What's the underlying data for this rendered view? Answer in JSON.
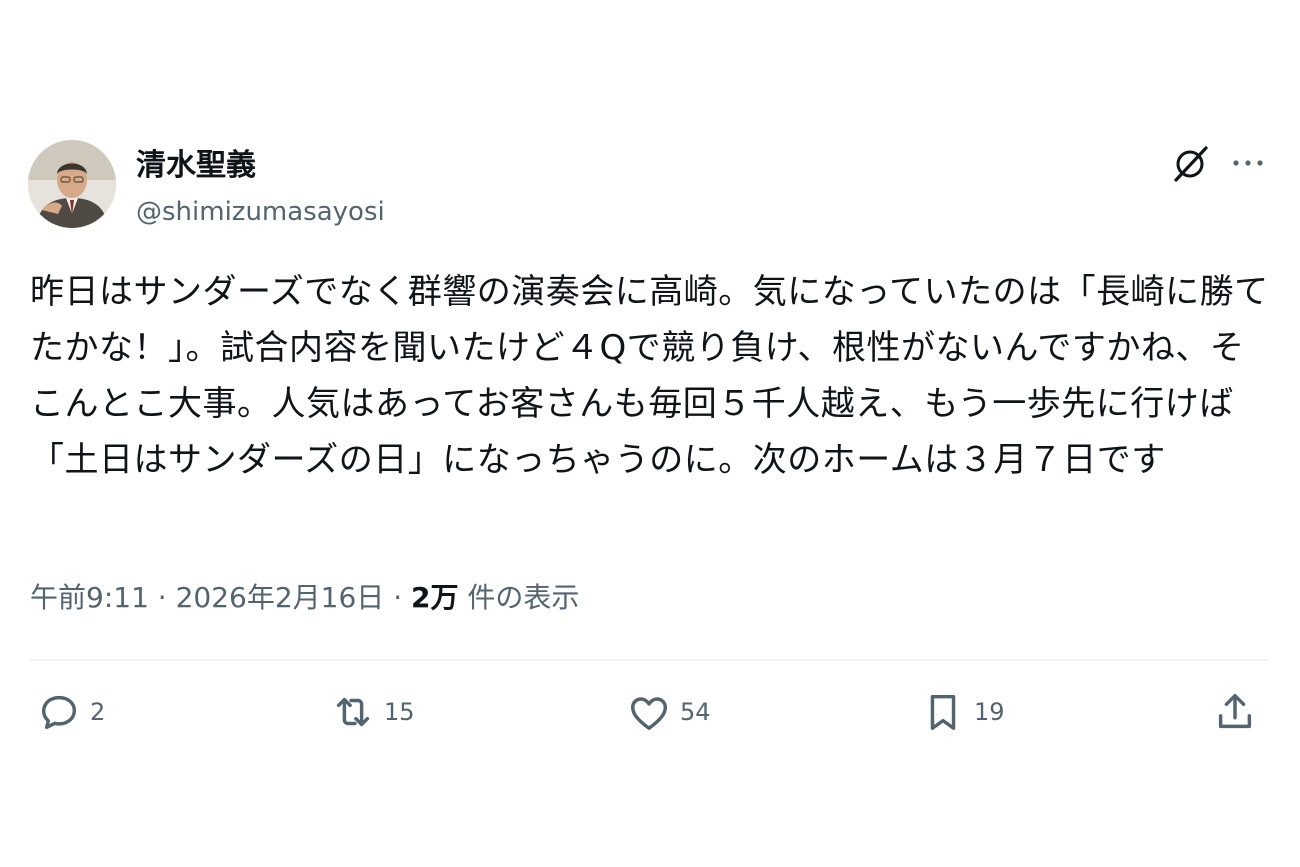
{
  "user": {
    "display_name": "清水聖義",
    "handle": "@shimizumasayosi"
  },
  "tweet": {
    "text": "昨日はサンダーズでなく群響の演奏会に高崎。気になっていたのは「長崎に勝てたかな！」。試合内容を聞いたけど４Qで競り負け、根性がないんですかね、そこんとこ大事。人気はあってお客さんも毎回５千人越え、もう一歩先に行けば「土日はサンダーズの日」になっちゃうのに。次のホームは３月７日です",
    "time": "午前9:11",
    "separator": "·",
    "date": "2026年2月16日",
    "views_count": "2万",
    "views_label": "件の表示"
  },
  "actions": {
    "reply_count": "2",
    "repost_count": "15",
    "like_count": "54",
    "bookmark_count": "19"
  },
  "icons": {
    "header": [
      "grok-icon",
      "more-icon"
    ],
    "actions": [
      "reply-icon",
      "repost-icon",
      "like-icon",
      "bookmark-icon",
      "share-icon"
    ]
  },
  "colors": {
    "text_primary": "#0f1419",
    "text_secondary": "#536471",
    "divider": "#eff3f4"
  }
}
